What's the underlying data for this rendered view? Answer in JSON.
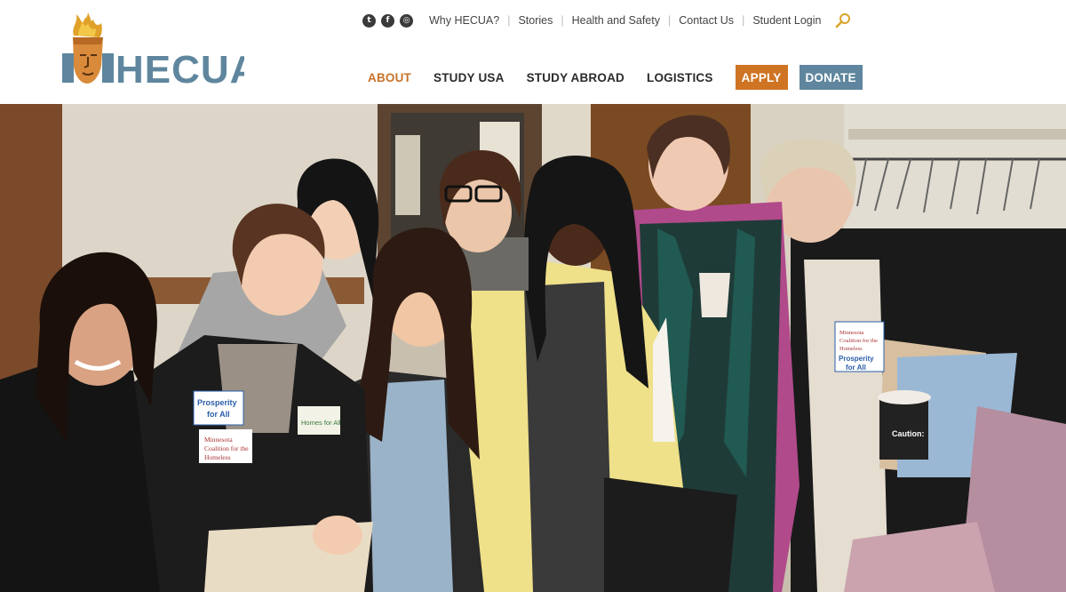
{
  "site": {
    "logo_text": "HECUA",
    "brand_colors": {
      "orange": "#cf7423",
      "slate": "#5f869e",
      "active_nav": "#c8722a"
    }
  },
  "utility_nav": {
    "social": [
      {
        "icon": "twitter-icon",
        "glyph": "t"
      },
      {
        "icon": "facebook-icon",
        "glyph": "f"
      },
      {
        "icon": "instagram-icon",
        "glyph": "◎"
      }
    ],
    "links": [
      "Why HECUA?",
      "Stories",
      "Health and Safety",
      "Contact Us",
      "Student Login"
    ],
    "search_icon": "search-icon"
  },
  "main_nav": {
    "items": [
      "ABOUT",
      "STUDY USA",
      "STUDY ABROAD",
      "LOGISTICS"
    ],
    "active": "ABOUT",
    "apply_label": "APPLY",
    "donate_label": "DONATE"
  },
  "hero": {
    "badges": {
      "prosperity_left": "Prosperity for All",
      "homes_for_all": "Homes for All",
      "mn_coalition_left": "Minnesota Coalition for the Homeless",
      "mn_coalition_right": "Minnesota Coalition for the Homeless",
      "prosperity_right": "Prosperity for All",
      "cup_text": "Caution:"
    }
  }
}
